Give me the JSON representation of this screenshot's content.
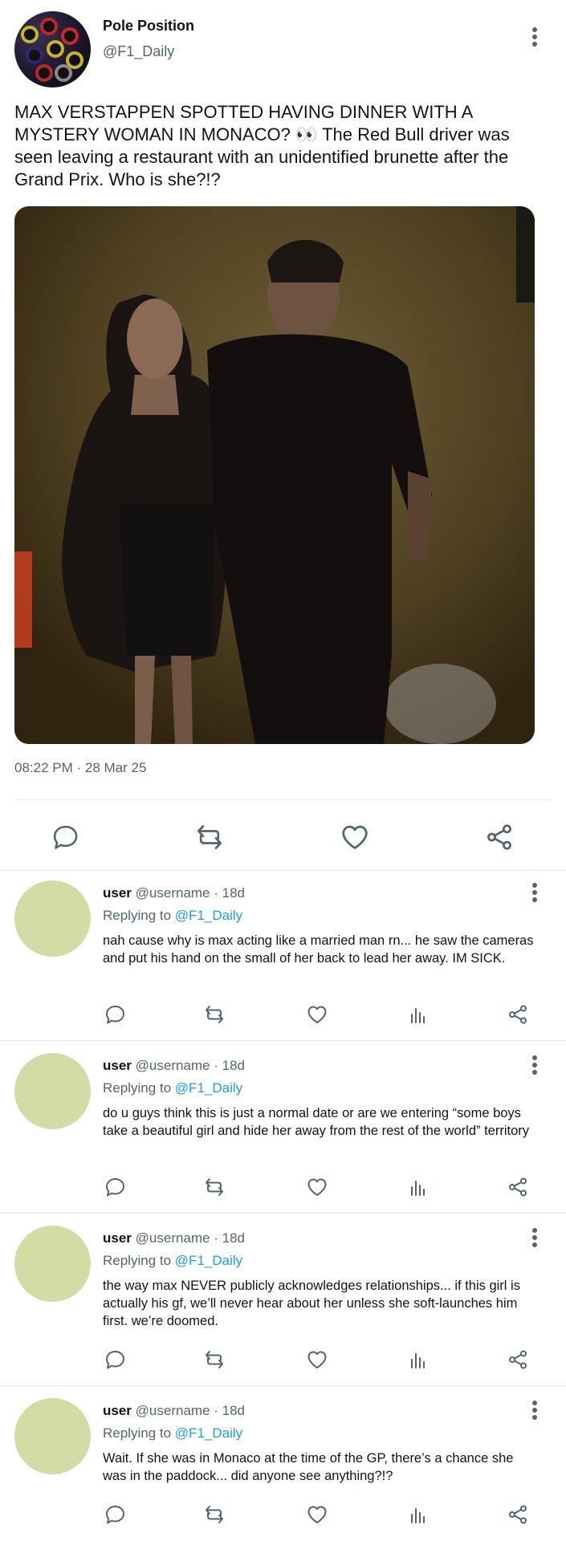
{
  "main_tweet": {
    "author_name": "Pole Position",
    "author_handle": "@F1_Daily",
    "text": "MAX VERSTAPPEN SPOTTED HAVING DINNER WITH A MYSTERY WOMAN IN MONACO? 👀 The Red Bull driver was seen leaving a restaurant with an unidentified brunette after the Grand Prix. Who is she?!?",
    "timestamp": "08:22 PM · 28 Mar 25",
    "photo_name": "photo-of-couple"
  },
  "icons": {
    "reply": "comment-icon",
    "retweet": "retweet-icon",
    "like": "heart-icon",
    "views": "bar-chart-icon",
    "share": "share-icon",
    "more": "more-vertical-icon"
  },
  "colors": {
    "text": "#0f1419",
    "secondary": "#536471",
    "link": "#1d9bf0",
    "avatar_placeholder": "#d2dca4"
  },
  "replies": [
    {
      "user": "user",
      "handle_time": "@username · 18d",
      "replying_prefix": "Replying to",
      "replying_handle": "@F1_Daily",
      "text": "nah cause why is max acting like a married man rn... he saw the cameras and put his hand on the small of her back to lead her away. IM SICK."
    },
    {
      "user": "user",
      "handle_time": "@username · 18d",
      "replying_prefix": "Replying to",
      "replying_handle": "@F1_Daily",
      "text": "do u guys think this is just a normal date or are we entering “some boys take a beautiful girl and hide her away from the rest of the world” territory"
    },
    {
      "user": "user",
      "handle_time": "@username · 18d",
      "replying_prefix": "Replying to",
      "replying_handle": "@F1_Daily",
      "text": "the way max NEVER publicly acknowledges relationships... if this girl is actually his gf, we’ll never hear about her unless she soft-launches him first. we’re doomed."
    },
    {
      "user": "user",
      "handle_time": "@username · 18d",
      "replying_prefix": "Replying to",
      "replying_handle": "@F1_Daily",
      "text": "Wait. If she was in Monaco at the time of the GP, there’s a chance she was in the paddock... did anyone see anything?!?"
    }
  ]
}
